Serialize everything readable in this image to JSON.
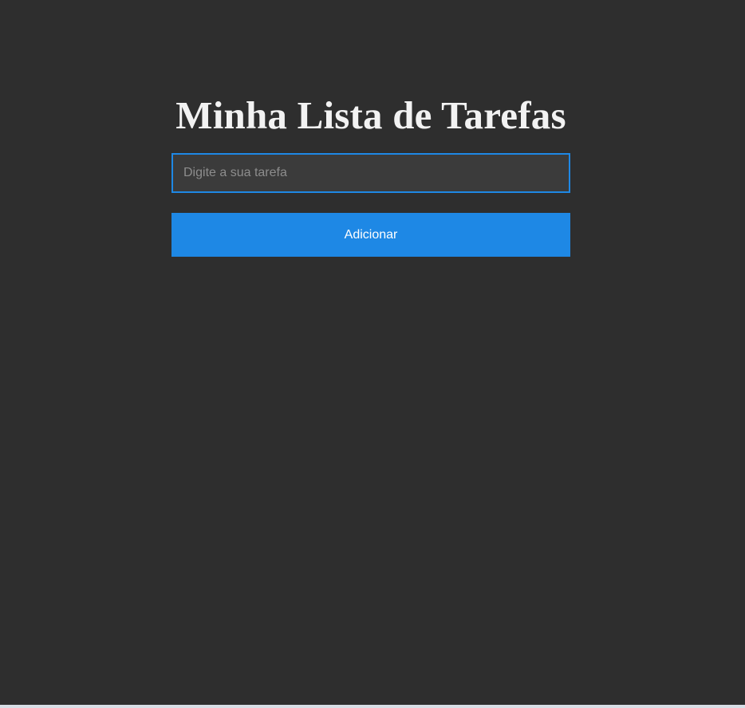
{
  "app": {
    "title": "Minha Lista de Tarefas"
  },
  "task_form": {
    "input_value": "",
    "input_placeholder": "Digite a sua tarefa",
    "add_button_label": "Adicionar"
  },
  "colors": {
    "background": "#2e2e2e",
    "input_background": "#3b3b3b",
    "accent": "#1e88e5",
    "title_text": "#f2f2f2",
    "button_text": "#ffffff"
  }
}
